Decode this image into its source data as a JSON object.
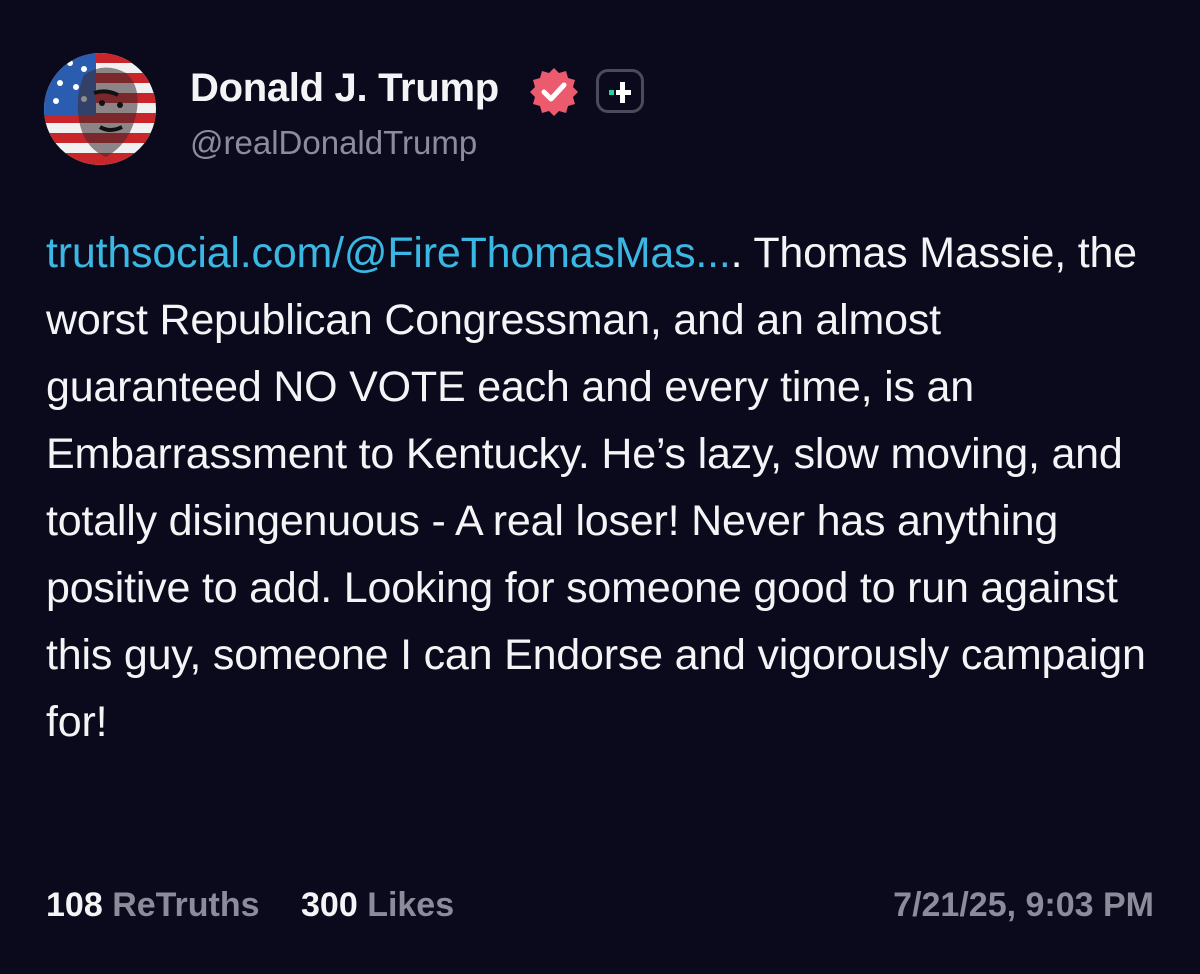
{
  "author": {
    "display_name": "Donald J. Trump",
    "handle": "@realDonaldTrump",
    "avatar_icon": "avatar-flag-portrait",
    "verified_icon": "verified-badge-icon",
    "plus_icon": "truth-plus-badge-icon"
  },
  "post": {
    "link_text": "truthsocial.com/@FireThomasMas...",
    "body_text": ". Thomas Massie, the worst Republican Congressman, and an almost guaranteed NO VOTE each and every time, is an Embarrassment to Kentucky. He’s lazy, slow moving, and totally disingenuous - A real loser! Never has anything positive to add. Looking for someone good to run against this guy, someone I can Endorse and vigorously campaign for!"
  },
  "stats": {
    "retruths_count": "108",
    "retruths_label": "ReTruths",
    "likes_count": "300",
    "likes_label": "Likes"
  },
  "timestamp": "7/21/25, 9:03 PM",
  "colors": {
    "background": "#0b0a1c",
    "text": "#f4f4f6",
    "muted": "#8c8b9c",
    "link": "#3ab7e2",
    "verified": "#ec5a6e",
    "plus_accent": "#22d3a6"
  }
}
